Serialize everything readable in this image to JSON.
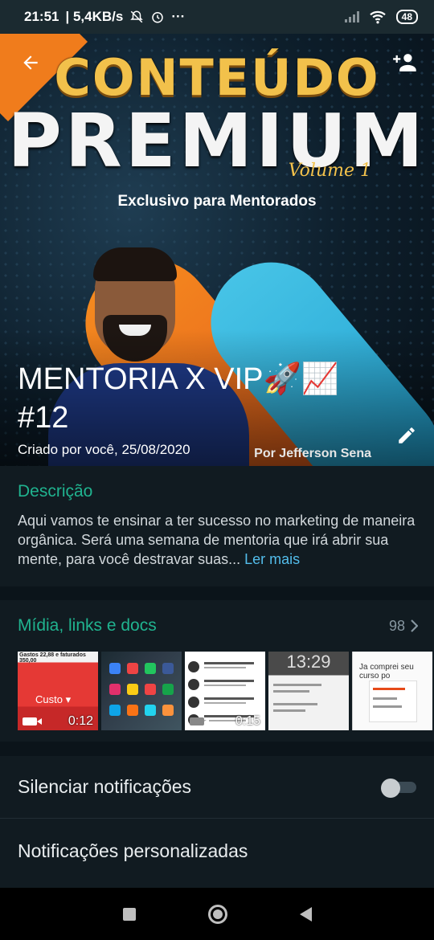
{
  "status_bar": {
    "time": "21:51",
    "network_speed": "| 5,4KB/s",
    "more": "···",
    "battery": "48"
  },
  "header": {
    "group_name": "MENTORIA X VIP🚀📈 #12",
    "created": "Criado por você, 25/08/2020",
    "image": {
      "title_line1": "CONTEÚDO",
      "title_line2": "PREMIUM",
      "volume": "Volume 1",
      "subtitle": "Exclusivo para Mentorados",
      "byline": "Por Jefferson Sena"
    }
  },
  "description": {
    "title": "Descrição",
    "text": "Aqui vamos te ensinar a ter sucesso no marketing de maneira orgânica. Será uma semana de mentoria que irá abrir sua mente, para você destravar suas... ",
    "read_more": "Ler mais"
  },
  "media": {
    "title": "Mídia, links e docs",
    "count": "98",
    "thumbnails": [
      {
        "type": "video",
        "duration": "0:12",
        "top_text": "Gastos 22,88 e faturados 350,00",
        "label": "Custo ▾"
      },
      {
        "type": "image"
      },
      {
        "type": "video",
        "duration": "0:15"
      },
      {
        "type": "image",
        "clock": "13:29"
      },
      {
        "type": "image",
        "text": "Ja comprei seu curso po"
      }
    ]
  },
  "settings": {
    "mute_label": "Silenciar notificações",
    "mute_enabled": false,
    "custom_label": "Notificações personalizadas"
  },
  "colors": {
    "accent_green": "#20b38f",
    "link_blue": "#53bdeb",
    "background": "#111b21"
  }
}
